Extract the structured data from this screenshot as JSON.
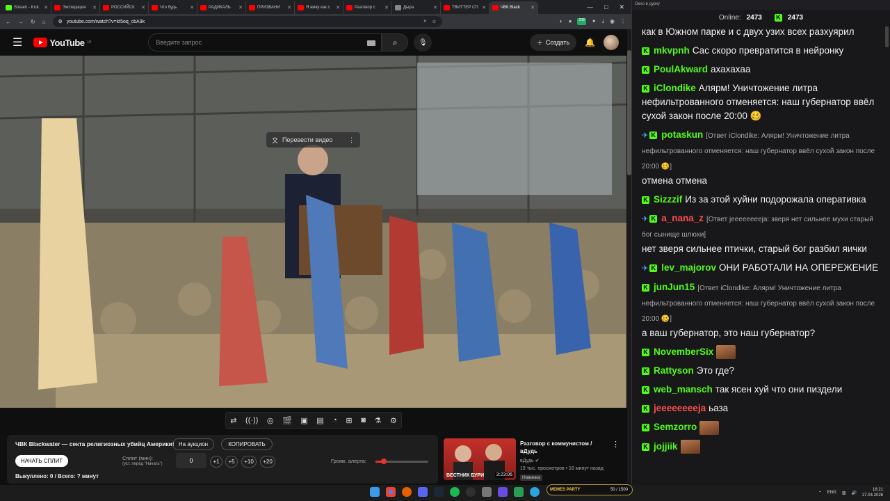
{
  "browser": {
    "tabs": [
      {
        "label": "Stream - Kick",
        "color": "#53fc18"
      },
      {
        "label": "Экспедиция",
        "color": "#ff0000"
      },
      {
        "label": "РОССИЙСК",
        "color": "#ff0000"
      },
      {
        "label": "Что будь",
        "color": "#ff0000"
      },
      {
        "label": "РАДИКАЛЬ",
        "color": "#ff0000"
      },
      {
        "label": "ПРИЗВАНИ",
        "color": "#ff0000"
      },
      {
        "label": "Я живу как с",
        "color": "#ff0000"
      },
      {
        "label": "Разговор с",
        "color": "#ff0000"
      },
      {
        "label": "Дыра",
        "color": "#888888"
      },
      {
        "label": "ТВИТТЕР СП",
        "color": "#ff0000"
      },
      {
        "label": "ЧВК Black",
        "color": "#ff0000",
        "active": true
      }
    ],
    "url": "youtube.com/watch?v=kt5oq_cbA9k",
    "ext_badge": "208"
  },
  "youtube": {
    "logo_text": "YouTube",
    "region": "LV",
    "search_placeholder": "Введите запрос",
    "create_label": "Создать"
  },
  "video": {
    "translate_label": "Перевести видео"
  },
  "panel": {
    "title": "ЧВК Blackwater — секта религиозных убийц Америки!",
    "auction_label": "На аукцион",
    "copy_label": "КОПИРОВАТЬ",
    "split_button": "НАЧАТЬ СПЛИТ",
    "split_label": "Сплит (мин):",
    "split_hint": "(уст. перед \"Начать\")",
    "split_value": "0",
    "increments": [
      "+1",
      "+5",
      "+10",
      "+20"
    ],
    "bought": "Выкуплено: 0 / Всего: ? минут",
    "volume_label": "Громк. алерта:",
    "volume_level": 0.1
  },
  "recommended": {
    "title": "Разговор с коммунистом / вДудь",
    "channel": "вДудь",
    "meta": "19 тыс. просмотров • 16 минут назад",
    "badge": "Новинка",
    "duration": "3:23:06",
    "thumb_text": "ВЕСТНИК БУРИ"
  },
  "chat": {
    "window_title": "Окно в дурку",
    "online_label": "Online:",
    "online_count": "2473",
    "viewers": "2473",
    "messages": [
      {
        "user": "",
        "text": "как в Южном парке и с двух узих всех разхуярил",
        "cont": true
      },
      {
        "user": "mkvpnh",
        "text": "Сас скоро превратится в нейронку"
      },
      {
        "user": "PoulAkward",
        "text": "ахахахаа"
      },
      {
        "user": "iClondike",
        "text": "Алярм! Уничтожение литра нефильтрованного отменяется: наш губернатор ввёл сухой закон после 20:00 🥴"
      },
      {
        "user": "potaskun",
        "reply": "[Ответ iClondike: Алярм! Уничтожение литра нефильтрованного отменяется: наш губернатор ввёл сухой закон после 20:00 🥴]",
        "text": "отмена отмена",
        "badge": true
      },
      {
        "user": "Sizzzif",
        "text": "Из за этой хуйни подорожала оперативка"
      },
      {
        "user": "a_nana_z",
        "reply": "[Ответ jeeeeeeeeja: зверя нет сильнее мухи старый бог сынище шлюхи]",
        "text": "нет зверя сильнее птички, старый бог разбил яички",
        "badge": true,
        "color": "#ff4d4d"
      },
      {
        "user": "lev_majorov",
        "text": "ОНИ РАБОТАЛИ НА ОПЕРЕЖЕНИЕ",
        "badge": true
      },
      {
        "user": "junJun15",
        "reply": "[Ответ iClondike: Алярм! Уничтожение литра нефильтрованного отменяется: наш губернатор ввёл сухой закон после 20:00 🥴]",
        "text": "а ваш губернатор, это наш губернатор?"
      },
      {
        "user": "NovemberSix",
        "text": "",
        "emote": true
      },
      {
        "user": "Rattyson",
        "text": "Это где?"
      },
      {
        "user": "web_mansch",
        "text": "так ясен хуй что они пиздели"
      },
      {
        "user": "jeeeeeeeeja",
        "text": "ьаза",
        "color": "#ff4d4d"
      },
      {
        "user": "Semzorro",
        "text": "",
        "emote": true
      },
      {
        "user": "jojjiik",
        "text": "",
        "emote": true
      }
    ]
  },
  "taskbar": {
    "lang": "ENG",
    "time": "18:21",
    "date": "27.04.2026",
    "meme_label": "MEMES PARTY",
    "meme_count": "50 / 1500"
  }
}
